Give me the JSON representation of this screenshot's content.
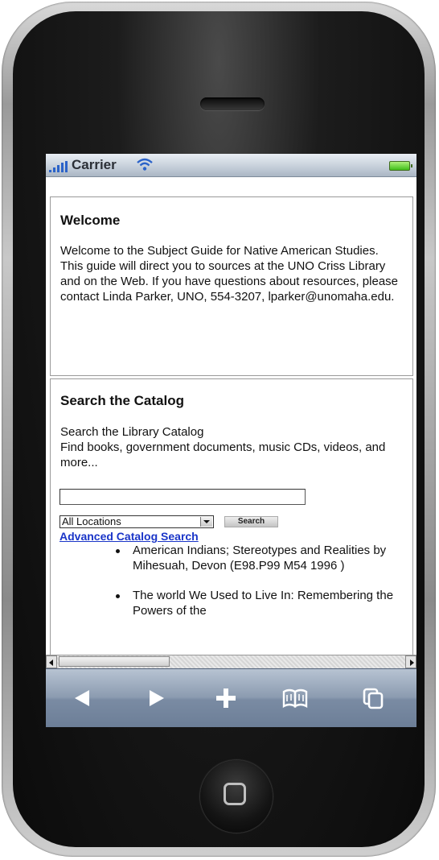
{
  "status_bar": {
    "carrier": "Carrier",
    "signal_icon": "signal-bars-icon",
    "wifi_icon": "wifi-icon",
    "battery_icon": "battery-icon"
  },
  "welcome": {
    "title": "Welcome",
    "body": "Welcome to the Subject Guide for Native American Studies. This guide will direct you to sources at the UNO Criss Library and on the Web. If you have questions about resources, please contact Linda Parker, UNO, 554-3207, lparker@unomaha.edu."
  },
  "search": {
    "title": "Search the Catalog",
    "line1": "Search the Library Catalog",
    "line2": "Find books, government documents, music CDs, videos, and more...",
    "query_value": "",
    "location_selected": "All Locations",
    "search_button": "Search",
    "advanced_link": "Advanced Catalog Search",
    "results": [
      "American Indians; Stereotypes and Realities by Mihesuah, Devon (E98.P99 M54 1996 )",
      "The world We Used to Live In: Remembering the Powers of the"
    ]
  },
  "toolbar": {
    "back_icon": "back-arrow-icon",
    "forward_icon": "forward-arrow-icon",
    "add_icon": "plus-icon",
    "bookmarks_icon": "book-icon",
    "pages_icon": "pages-icon"
  },
  "colors": {
    "link": "#1a35c8",
    "toolbar": "#7a8ba3",
    "battery": "#3fbf1a"
  }
}
